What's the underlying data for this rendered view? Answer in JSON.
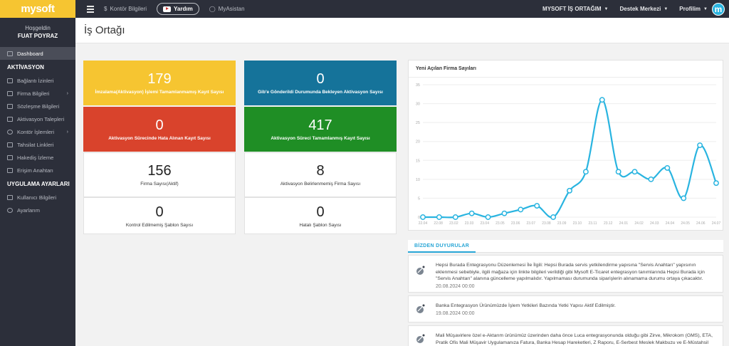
{
  "topbar": {
    "brand": "mysoft",
    "links": [
      {
        "label": "Kontör Bilgileri"
      },
      {
        "label": "Yardım"
      },
      {
        "label": "MyAsistan"
      }
    ],
    "right_menus": [
      {
        "label": "MYSOFT İŞ ORTAĞIM"
      },
      {
        "label": "Destek Merkezi"
      },
      {
        "label": "Profilim"
      }
    ],
    "avatar_letter": "m"
  },
  "sidebar": {
    "greeting": "Hoşgeldin",
    "user_name": "FUAT POYRAZ",
    "dashboard": "Dashboard",
    "section1": "AKTİVASYON",
    "items1": [
      {
        "label": "Bağlantı İzinleri"
      },
      {
        "label": "Firma Bilgileri"
      },
      {
        "label": "Sözleşme Bilgileri"
      },
      {
        "label": "Aktivasyon Talepleri"
      },
      {
        "label": "Kontör İşlemleri"
      },
      {
        "label": "Tahsilat Linkleri"
      },
      {
        "label": "Hakediş İzleme"
      },
      {
        "label": "Erişim Anahtarı"
      }
    ],
    "section2": "UYGULAMA AYARLARI",
    "items2": [
      {
        "label": "Kullanıcı Bilgileri"
      },
      {
        "label": "Ayarlarım"
      }
    ]
  },
  "page": {
    "title": "İş Ortağı"
  },
  "tiles": [
    {
      "value": "179",
      "label": "İmzalama(Aktivasyon) İşlemi Tamamlanmamış Kayıt Sayısı",
      "color": "#f6c531"
    },
    {
      "value": "0",
      "label": "Gib'e Gönderildi Durumunda Bekleyen Aktivasyon Sayısı",
      "color": "#15739a"
    },
    {
      "value": "0",
      "label": "Aktivasyon Sürecinde Hata Alınan Kayıt Sayısı",
      "color": "#d9432c"
    },
    {
      "value": "417",
      "label": "Aktivasyon Süreci Tamamlanmış Kayıt Sayısı",
      "color": "#1f8e25"
    },
    {
      "value": "156",
      "label": "Firma Sayısı(Aktif)"
    },
    {
      "value": "8",
      "label": "Aktivasyon Belirlenmemiş Firma Sayısı"
    },
    {
      "value": "0",
      "label": "Kontrol Edilmemiş Şablon Sayısı"
    },
    {
      "value": "0",
      "label": "Hatalı Şablon Sayısı"
    }
  ],
  "chart_data": {
    "type": "line",
    "title": "Yeni Açılan Firma Sayıları",
    "categories": [
      "22.04",
      "22.08",
      "23.02",
      "23.03",
      "23.04",
      "23.05",
      "23.06",
      "23.07",
      "23.08",
      "23.09",
      "23.10",
      "23.11",
      "23.12",
      "24.01",
      "24.02",
      "24.03",
      "24.04",
      "24.05",
      "24.06",
      "24.07"
    ],
    "values": [
      0,
      0,
      0,
      1,
      0,
      1,
      2,
      3,
      0,
      7,
      12,
      31,
      12,
      12,
      10,
      13,
      5,
      19,
      9
    ],
    "ylim": [
      0,
      35
    ],
    "yticks": [
      0,
      5,
      10,
      15,
      20,
      25,
      30,
      35
    ],
    "color": "#29b4e0",
    "grid": true
  },
  "announcements": {
    "tab": "BİZDEN DUYURULAR",
    "items": [
      {
        "text": "Hepsi Burada Entegrasyonu Düzenlemesi İle İlgili: Hepsi Burada servis yetkilendirme yapısına \"Servis Anahtarı\" yapısının eklenmesi sebebiyle, ilgili mağaza için linkte bilgileri verildiği gibi Mysoft E-Ticaret entegrasyon tanımlarında Hepsi Burada için \"Servis Anahtarı\" alanına güncelleme yapılmalıdır. Yapılmaması durumunda siparişlerin alınamama durumu ortaya çıkacaktır.",
        "date": "20.08.2024 00:00"
      },
      {
        "text": "Banka Entegrasyon Ürünümüzde İşlem Yetkileri Bazında Yetki Yapısı Aktif Edilmiştir.",
        "date": "19.08.2024 00:00"
      },
      {
        "text": "Mali Müşavirlere özel e-Aktarım ürünümüz üzerinden daha önce Luca entegrasyonunda olduğu gibi Zirve, Mikrokom (GMS), ETA, Pratik Ofis Mali Müşavir Uygulamanıza Fatura, Banka Hesap Hareketleri, Z Raporu, E-Serbest Meslek Makbuzu ve E-Müstahsil",
        "date": ""
      }
    ]
  }
}
